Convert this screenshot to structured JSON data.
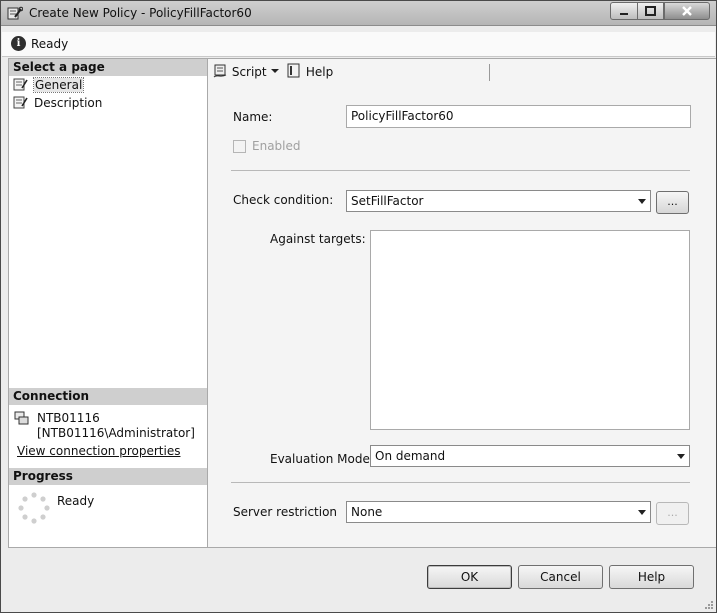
{
  "window": {
    "title": "Create New Policy - PolicyFillFactor60",
    "status": "Ready"
  },
  "icons": {
    "app": "policy-wrench-icon",
    "status": "info-icon",
    "page": "page-icon",
    "server": "server-icon",
    "progress": "spinner-icon",
    "script": "script-icon",
    "help": "help-icon"
  },
  "sidebar": {
    "pages_header": "Select a page",
    "pages": [
      {
        "label": "General",
        "selected": true
      },
      {
        "label": "Description",
        "selected": false
      }
    ],
    "connection_header": "Connection",
    "connection_server": "NTB01116",
    "connection_user": "[NTB01116\\Administrator]",
    "connection_link": "View connection properties",
    "progress_header": "Progress",
    "progress_status": "Ready"
  },
  "toolbar": {
    "script_label": "Script",
    "help_label": "Help"
  },
  "form": {
    "name_label": "Name:",
    "name_value": "PolicyFillFactor60",
    "enabled_label": "Enabled",
    "enabled_checked": false,
    "check_condition_label": "Check condition:",
    "check_condition_value": "SetFillFactor",
    "ellipsis": "...",
    "against_targets_label": "Against targets:",
    "evaluation_mode_label": "Evaluation Mode:",
    "evaluation_mode_value": "On demand",
    "server_restriction_label": "Server restriction",
    "server_restriction_value": "None"
  },
  "buttons": {
    "ok": "OK",
    "cancel": "Cancel",
    "help": "Help"
  }
}
